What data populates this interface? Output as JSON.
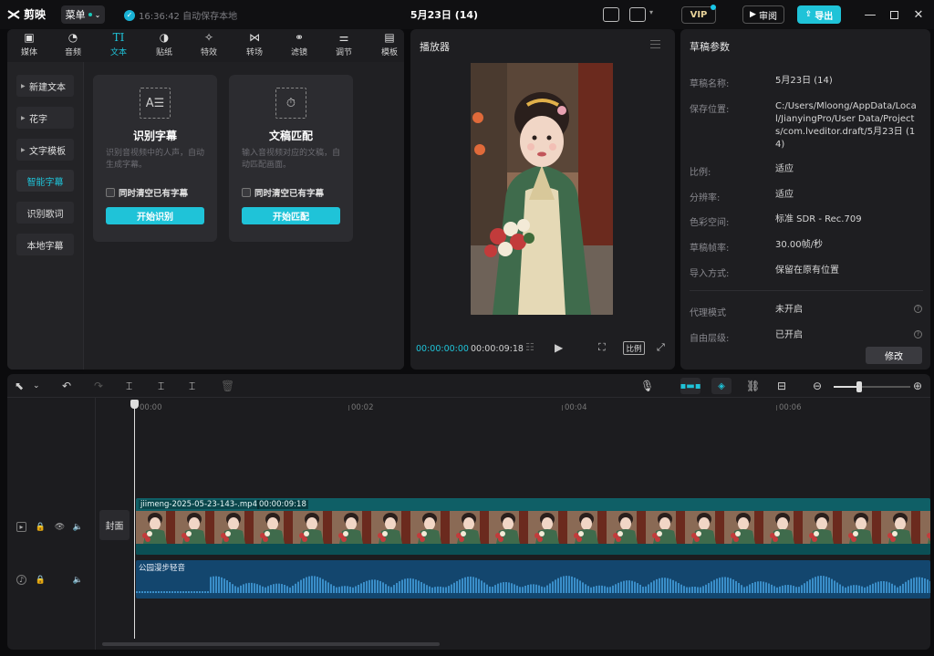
{
  "app": {
    "name": "剪映",
    "menu_label": "菜单",
    "autosave": "16:36:42 自动保存本地",
    "project_title": "5月23日 (14)",
    "vip": "VIP",
    "review": "审阅",
    "export": "导出"
  },
  "tool_tabs": [
    {
      "label": "媒体",
      "icon": "media-icon"
    },
    {
      "label": "音频",
      "icon": "audio-icon"
    },
    {
      "label": "文本",
      "icon": "text-icon",
      "active": true
    },
    {
      "label": "贴纸",
      "icon": "sticker-icon"
    },
    {
      "label": "特效",
      "icon": "effects-icon"
    },
    {
      "label": "转场",
      "icon": "transition-icon"
    },
    {
      "label": "滤镜",
      "icon": "filter-icon"
    },
    {
      "label": "调节",
      "icon": "adjust-icon"
    },
    {
      "label": "模板",
      "icon": "template-icon"
    }
  ],
  "side_menu": [
    "新建文本",
    "花字",
    "文字模板",
    "智能字幕",
    "识别歌词",
    "本地字幕"
  ],
  "cards": [
    {
      "title": "识别字幕",
      "desc": "识别音视频中的人声，自动生成字幕。",
      "checkbox": "同时清空已有字幕",
      "button": "开始识别"
    },
    {
      "title": "文稿匹配",
      "desc": "输入音视频对应的文稿，自动匹配画面。",
      "checkbox": "同时清空已有字幕",
      "button": "开始匹配"
    }
  ],
  "player": {
    "title": "播放器",
    "current_time": "00:00:00:00",
    "total_time": "00:00:09:18",
    "ratio_label": "比例"
  },
  "params": {
    "title": "草稿参数",
    "rows": [
      {
        "label": "草稿名称:",
        "value": "5月23日 (14)"
      },
      {
        "label": "保存位置:",
        "value": "C:/Users/Mloong/AppData/Local/JianyingPro/User Data/Projects/com.lveditor.draft/5月23日 (14)"
      },
      {
        "label": "比例:",
        "value": "适应"
      },
      {
        "label": "分辨率:",
        "value": "适应"
      },
      {
        "label": "色彩空间:",
        "value": "标准 SDR - Rec.709"
      },
      {
        "label": "草稿帧率:",
        "value": "30.00帧/秒"
      },
      {
        "label": "导入方式:",
        "value": "保留在原有位置"
      },
      {
        "label": "代理模式",
        "value": "未开启"
      },
      {
        "label": "自由层级:",
        "value": "已开启"
      }
    ],
    "modify": "修改"
  },
  "timeline": {
    "ruler": [
      "00:00",
      "00:02",
      "00:04",
      "00:06"
    ],
    "cover": "封面",
    "video_clip": {
      "name": "jiimeng-2025-05-23-143-.mp4",
      "duration": "00:00:09:18"
    },
    "audio_clip": {
      "name": "公园漫步轻音"
    }
  },
  "colors": {
    "accent": "#1fc3d8",
    "video_track": "#0f5f66",
    "audio_track": "#13466e"
  }
}
